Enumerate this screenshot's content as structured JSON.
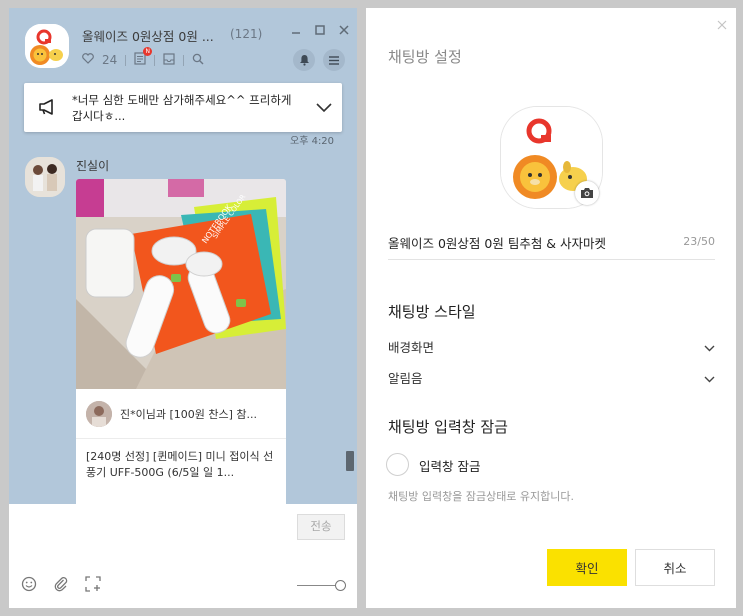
{
  "chat": {
    "room_title": "올웨이즈 0원상점 0원 ...",
    "member_count": "(121)",
    "like_count": "24",
    "notice_text": "*너무 심한 도배만 삼가해주세요^^ 프리하게 갑시다ㅎ...",
    "message_time": "오후 4:20",
    "sender_name": "진실이",
    "card_row1": "진*이님과 [100원 찬스] 참...",
    "card_row2": "[240명 선정] [퀸메이드] 미니 접이식 선풍기 UFF-500G (6/5일 일 1...",
    "send_label": "전송",
    "badge": "N"
  },
  "settings": {
    "title": "채팅방 설정",
    "room_name": "올웨이즈 0원상점 0원 팀추첨 & 사자마켓",
    "name_count": "23/50",
    "style_section": "채팅방 스타일",
    "background_label": "배경화면",
    "notification_label": "알림음",
    "lock_section": "채팅방 입력창 잠금",
    "lock_checkbox_label": "입력창 잠금",
    "lock_helper": "채팅방 입력창을 잠금상태로 유지합니다.",
    "ok_label": "확인",
    "cancel_label": "취소"
  },
  "colors": {
    "chat_background": "#b2c7da",
    "confirm_button": "#fae100",
    "brand_red": "#e8362c"
  }
}
